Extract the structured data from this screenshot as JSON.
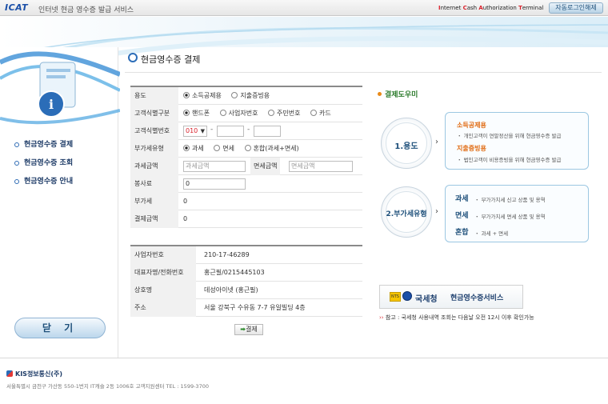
{
  "window": {
    "logo": "ICAT",
    "title": "인터넷 현금 영수증 발급 서비스",
    "acronym_parts": [
      "I",
      "nternet ",
      "C",
      "ash ",
      "A",
      "uthorization ",
      "T",
      "erminal"
    ],
    "auto_logout": "자동로그인해제"
  },
  "sidebar": {
    "items": [
      {
        "label": "현금영수증 결제"
      },
      {
        "label": "현금영수증 조회"
      },
      {
        "label": "현금영수증 안내"
      }
    ],
    "close_label": "닫 기"
  },
  "page": {
    "title": "현금영수증 결제"
  },
  "form": {
    "use": {
      "label": "용도",
      "options": [
        "소득공제용",
        "지출증빙용"
      ],
      "selected": 0
    },
    "id_type": {
      "label": "고객식별구분",
      "options": [
        "핸드폰",
        "사업자번호",
        "주민번호",
        "카드"
      ],
      "selected": 0
    },
    "id_number": {
      "label": "고객식별번호",
      "prefix": "010",
      "dash": "-"
    },
    "vat_type": {
      "label": "부가세유형",
      "options": [
        "과세",
        "면세",
        "혼합(과세+면세)"
      ],
      "selected": 0
    },
    "taxable": {
      "label": "과세금액",
      "placeholder": "과세금액"
    },
    "exempt": {
      "label": "면세금액",
      "placeholder": "면세금액"
    },
    "service_fee": {
      "label": "봉사료",
      "value": "0"
    },
    "vat": {
      "label": "부가세",
      "value": "0"
    },
    "total": {
      "label": "결제금액",
      "value": "0"
    }
  },
  "merchant": {
    "rows": [
      {
        "label": "사업자번호",
        "value": "210-17-46289"
      },
      {
        "label": "대표자명/전화번호",
        "value": "홍근필/0215445103"
      },
      {
        "label": "상호명",
        "value": "데성아이넷 (홍근필)"
      },
      {
        "label": "주소",
        "value": "서울 강북구 수유동 7-7 유일빌딩 4층"
      }
    ]
  },
  "pay_button": {
    "label": "결제"
  },
  "help": {
    "title": "결제도우미",
    "use_circle": "1.용도",
    "vat_circle": "2.부가세유형",
    "use_box": {
      "h1": "소득공제용",
      "l1": "・ 개인고객이 연말정산을 위해 현금영수증 발급",
      "h2": "지출증빙용",
      "l2": "・ 법인고객이 비용증빙을 위해 현금영수증 발급"
    },
    "vat_box": [
      {
        "tag": "과세",
        "desc": "・ 부가가치세 신고 상품 및 용역"
      },
      {
        "tag": "면세",
        "desc": "・ 부가가치세 면세 상품 및 용역"
      },
      {
        "tag": "혼합",
        "desc": "・ 과세 + 면세"
      }
    ]
  },
  "nts": {
    "mark": "NTS",
    "name": "국세청",
    "service": "현금영수증서비스"
  },
  "note": {
    "arrow": "››",
    "text": "참고 : 국세청 사용내역 조회는 다음날 오전 12시 이후 확인가능"
  },
  "footer": {
    "company": "KIS정보통신(주)",
    "address": "서울특별시 금천구 가산동 550-1번지 IT캐슬 2동 1006호 고객지원센터   TEL : 1599-3700"
  },
  "colors": {
    "accent_blue": "#1d4f7a",
    "accent_red": "#d9232d",
    "accent_orange": "#e06a10",
    "help_green": "#2a7a2a"
  }
}
